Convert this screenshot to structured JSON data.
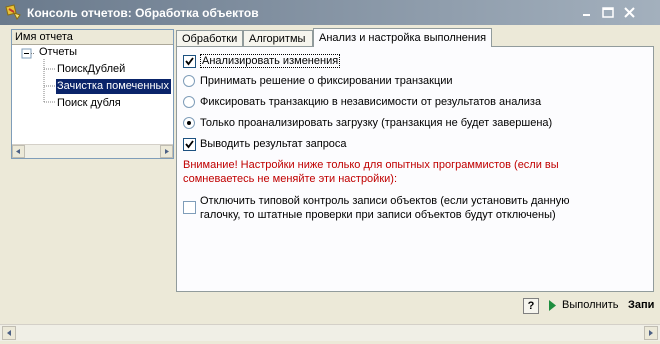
{
  "window": {
    "title": "Консоль отчетов: Обработка объектов"
  },
  "tree": {
    "header": "Имя отчета",
    "root_label": "Отчеты",
    "items": [
      {
        "label": "ПоискДублей",
        "selected": false
      },
      {
        "label": "Зачистка помеченных",
        "selected": true
      },
      {
        "label": "Поиск дубля",
        "selected": false
      }
    ]
  },
  "tabs": [
    {
      "label": "Обработки",
      "active": false
    },
    {
      "label": "Алгоритмы",
      "active": false
    },
    {
      "label": "Анализ и настройка выполнения",
      "active": true
    }
  ],
  "options": {
    "analyze_changes": {
      "label": "Анализировать изменения",
      "checked": true
    },
    "radio1": {
      "label": "Принимать решение о фиксировании транзакции",
      "selected": false
    },
    "radio2": {
      "label": "Фиксировать транзакцию в независимости от результатов анализа",
      "selected": false
    },
    "radio3": {
      "label": "Только проанализировать загрузку (транзакция не будет завершена)",
      "selected": true
    },
    "output_result": {
      "label": "Выводить результат запроса",
      "checked": true
    },
    "warning": "Внимание! Настройки ниже только для опытных программистов (если вы сомневаетесь не меняйте эти настройки):",
    "disable_control": {
      "label": "Отключить типовой контроль записи объектов (если установить данную галочку, то штатные проверки при записи объектов будут отключены)",
      "checked": false
    }
  },
  "toolbar": {
    "help_label": "?",
    "run_label": "Выполнить",
    "write_label": "Запи"
  },
  "colors": {
    "title_bar": "#7d8c9d",
    "selection": "#0a246a",
    "warning_text": "#c00000"
  }
}
